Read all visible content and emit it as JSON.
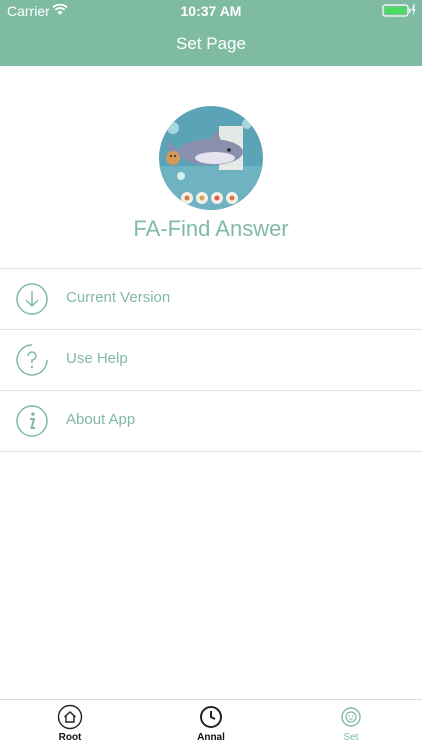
{
  "status_bar": {
    "carrier": "Carrier",
    "time": "10:37 AM"
  },
  "header": {
    "title": "Set Page"
  },
  "app": {
    "name": "FA-Find Answer"
  },
  "menu": [
    {
      "label": "Current Version",
      "icon": "download-circle-icon"
    },
    {
      "label": "Use Help",
      "icon": "question-circle-icon"
    },
    {
      "label": "About App",
      "icon": "info-circle-icon"
    }
  ],
  "tabs": [
    {
      "label": "Root",
      "icon": "home-icon"
    },
    {
      "label": "Annal",
      "icon": "clock-icon"
    },
    {
      "label": "Set",
      "icon": "face-icon",
      "active": true
    }
  ],
  "colors": {
    "accent": "#7fbba2",
    "divider": "#e3e3e3"
  }
}
